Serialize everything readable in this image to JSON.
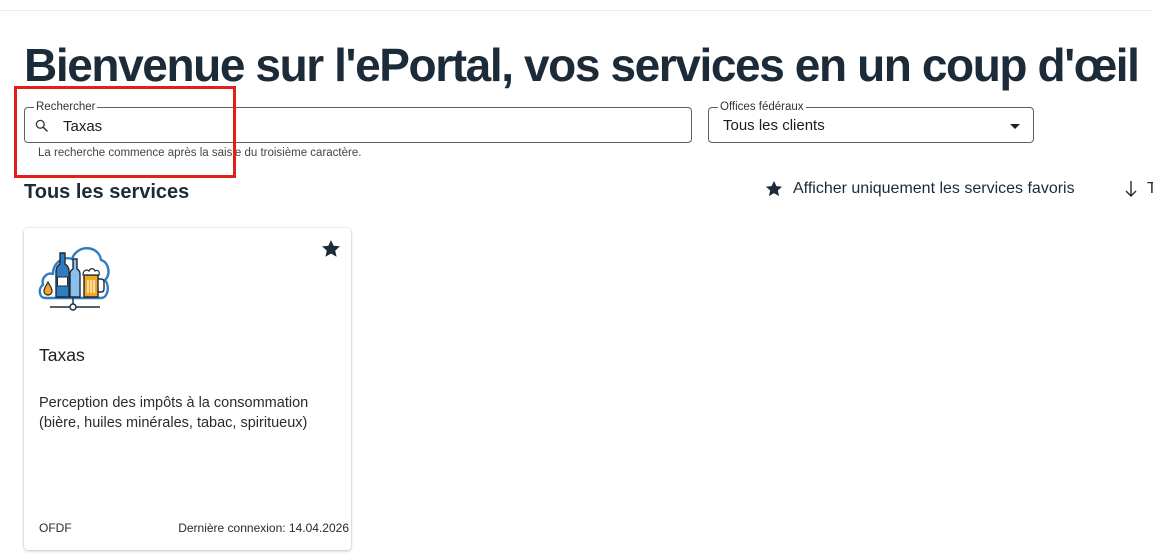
{
  "header": {
    "title": "Bienvenue sur l'ePortal, vos services en un coup d'œil"
  },
  "search": {
    "label": "Rechercher",
    "value": "Taxas",
    "helper": "La recherche commence après la saisie du troisième caractère.",
    "icon": "search-icon"
  },
  "office_filter": {
    "label": "Offices fédéraux",
    "selected": "Tous les clients",
    "icon": "chevron-down-icon"
  },
  "services": {
    "heading": "Tous les services",
    "favorites_toggle": {
      "label": "Afficher uniquement les services favoris",
      "icon": "star-icon"
    },
    "sort": {
      "label": "T",
      "icon": "arrow-down-icon"
    },
    "items": [
      {
        "title": "Taxas",
        "description": "Perception des impôts à la consommation (bière, huiles minérales, tabac, spiritueux)",
        "office": "OFDF",
        "last_login": "Dernière connexion: 14.04.2026",
        "favorite": true,
        "icon": "cloud-beverages-icon"
      }
    ]
  },
  "colors": {
    "ink": "#1c2b39",
    "accent-blue": "#2f7dc0",
    "accent-orange": "#f5a623",
    "highlight-red": "#e0201b",
    "field-border": "#5f5f5f"
  }
}
